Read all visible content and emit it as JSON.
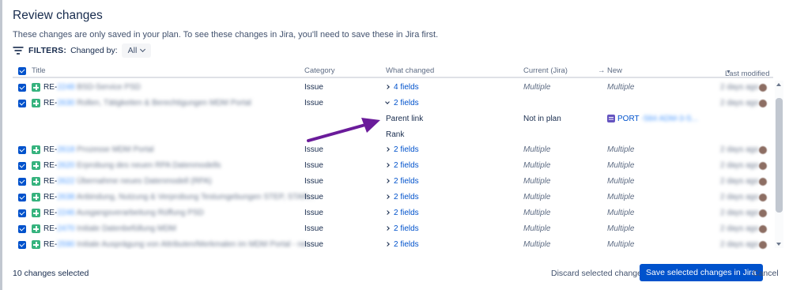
{
  "dialog": {
    "title": "Review changes",
    "subtitle": "These changes are only saved in your plan. To see these changes in Jira, you'll need to save these in Jira first."
  },
  "filters": {
    "label": "FILTERS:",
    "changed_by_label": "Changed by:",
    "changed_by_value": "All"
  },
  "table": {
    "headers": {
      "title": "Title",
      "category": "Category",
      "what_changed": "What changed",
      "current": "Current (Jira)",
      "new": "New",
      "last_modified": "Last modified"
    },
    "rows": [
      {
        "key_prefix": "RE-",
        "key_blur": "2248",
        "summary": "BSD-Service PSD",
        "category": "Issue",
        "what": "4 fields",
        "expanded": false,
        "current": "Multiple",
        "new": "Multiple",
        "modified": "2 days ago"
      },
      {
        "key_prefix": "RE-",
        "key_blur": "2630",
        "summary": "Rollen, Tätigkeiten & Berechtigungen MDM Portal",
        "category": "Issue",
        "what": "2 fields",
        "expanded": true,
        "current": "",
        "new": "",
        "modified": "2 days ago"
      },
      {
        "key_prefix": "RE-",
        "key_blur": "2618",
        "summary": "Prozesse MDM Portal",
        "category": "Issue",
        "what": "2 fields",
        "expanded": false,
        "current": "Multiple",
        "new": "Multiple",
        "modified": "2 days ago"
      },
      {
        "key_prefix": "RE-",
        "key_blur": "2620",
        "summary": "Erprobung des neuen RPA Datenmodells",
        "category": "Issue",
        "what": "2 fields",
        "expanded": false,
        "current": "Multiple",
        "new": "Multiple",
        "modified": "2 days ago"
      },
      {
        "key_prefix": "RE-",
        "key_blur": "2622",
        "summary": "Übernahme neues Datenmodell (RPA)",
        "category": "Issue",
        "what": "2 fields",
        "expanded": false,
        "current": "Multiple",
        "new": "Multiple",
        "modified": "2 days ago"
      },
      {
        "key_prefix": "RE-",
        "key_blur": "2638",
        "summary": "Anbindung, Nutzung & Verprobung Testumgebungen STEP, STAR...",
        "category": "Issue",
        "what": "2 fields",
        "expanded": false,
        "current": "Multiple",
        "new": "Multiple",
        "modified": "2 days ago"
      },
      {
        "key_prefix": "RE-",
        "key_blur": "2246",
        "summary": "Ausgangsverarbeitung Rüffung PSD",
        "category": "Issue",
        "what": "2 fields",
        "expanded": false,
        "current": "Multiple",
        "new": "Multiple",
        "modified": "2 days ago"
      },
      {
        "key_prefix": "RE-",
        "key_blur": "2470",
        "summary": "Initiale Datenbefüllung MDM",
        "category": "Issue",
        "what": "2 fields",
        "expanded": false,
        "current": "Multiple",
        "new": "Multiple",
        "modified": "2 days ago"
      },
      {
        "key_prefix": "RE-",
        "key_blur": "2590",
        "summary": "Initiale Ausprägung von Attributen/Merkmalen im MDM Portal - ne...",
        "category": "Issue",
        "what": "2 fields",
        "expanded": false,
        "current": "Multiple",
        "new": "Multiple",
        "modified": "2 days ago"
      }
    ],
    "expanded_fields": [
      {
        "field": "Parent link",
        "current": "Not in plan",
        "new_prefix": "PORT",
        "new_blur": "-584 ADM-3-S..."
      },
      {
        "field": "Rank",
        "current": "",
        "new_prefix": "",
        "new_blur": ""
      }
    ]
  },
  "footer": {
    "count": "10 changes selected",
    "discard": "Discard selected changes",
    "save": "Save selected changes in Jira",
    "cancel": "Cancel"
  },
  "colors": {
    "primary": "#0052cc",
    "story_icon": "#36b37e",
    "epic_icon": "#6554c0",
    "annotation_arrow": "#6a1b9a"
  }
}
